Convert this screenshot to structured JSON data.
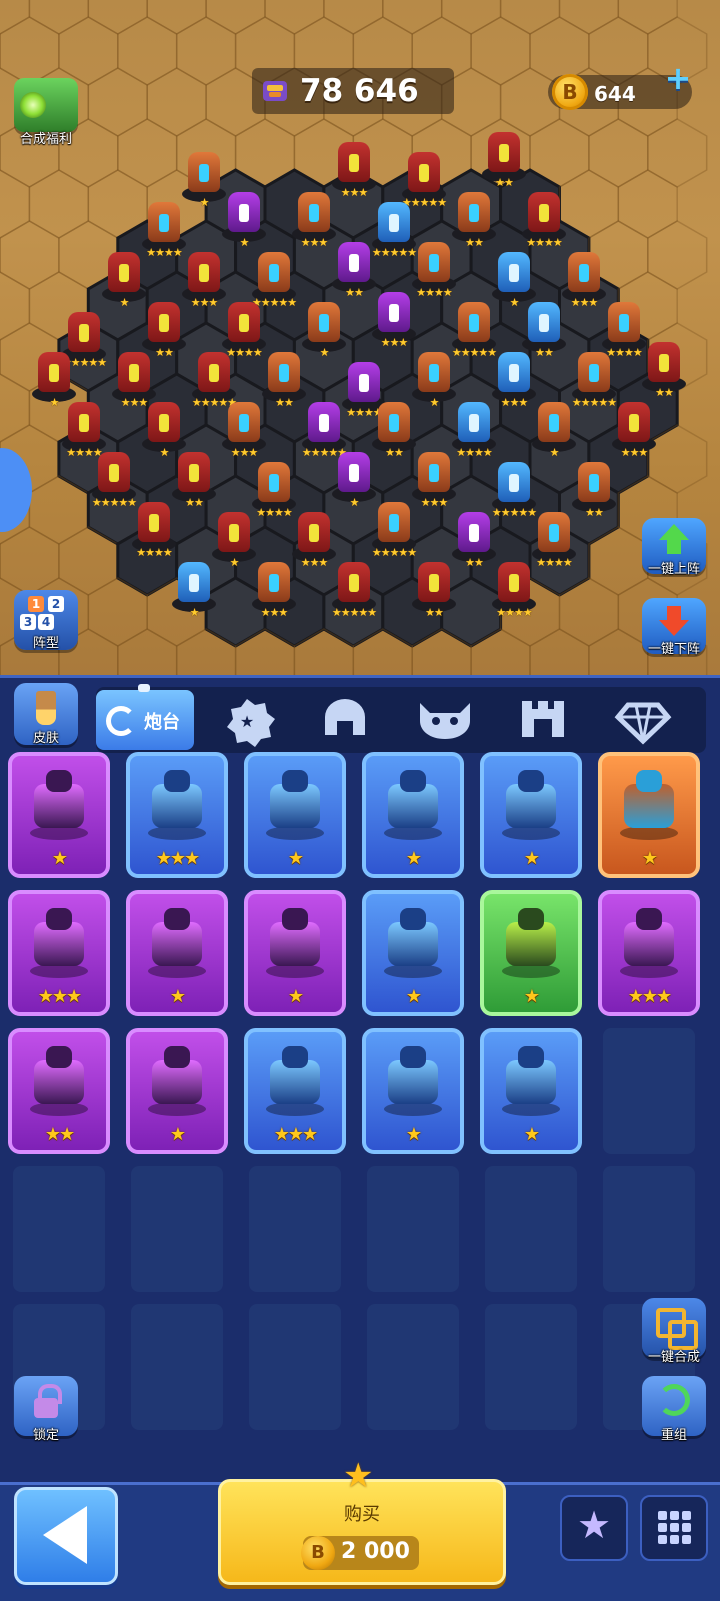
{
  "hud": {
    "score": "78 646",
    "coins": "644",
    "coin_symbol": "B",
    "plus_icon": "plus-icon"
  },
  "left_buttons": {
    "welfare_label": "合成福利",
    "formation_label": "阵型",
    "formation_digits": [
      "1",
      "2",
      "3",
      "4"
    ]
  },
  "right_buttons": {
    "deploy_all_label": "一键上阵",
    "remove_all_label": "一键下阵"
  },
  "tabs": {
    "skin_label": "皮肤",
    "active_label": "炮台",
    "items": [
      {
        "name": "turret",
        "icon": "turret-ring-icon"
      },
      {
        "name": "gear",
        "icon": "gear-badge-icon"
      },
      {
        "name": "helmet",
        "icon": "helmet-icon"
      },
      {
        "name": "skull",
        "icon": "horned-skull-icon"
      },
      {
        "name": "fortress",
        "icon": "fortress-icon"
      },
      {
        "name": "gem",
        "icon": "diamond-icon"
      }
    ]
  },
  "inventory": {
    "rows": [
      [
        {
          "color": "purple",
          "stars": "★"
        },
        {
          "color": "blue",
          "stars": "★★★"
        },
        {
          "color": "blue",
          "stars": "★"
        },
        {
          "color": "blue",
          "stars": "★"
        },
        {
          "color": "blue",
          "stars": "★"
        },
        {
          "color": "orange",
          "stars": "★"
        }
      ],
      [
        {
          "color": "purple",
          "stars": "★★★"
        },
        {
          "color": "purple",
          "stars": "★"
        },
        {
          "color": "purple",
          "stars": "★"
        },
        {
          "color": "blue",
          "stars": "★"
        },
        {
          "color": "green",
          "stars": "★"
        },
        {
          "color": "purple",
          "stars": "★★★"
        }
      ],
      [
        {
          "color": "purple",
          "stars": "★★"
        },
        {
          "color": "purple",
          "stars": "★"
        },
        {
          "color": "blue",
          "stars": "★★★"
        },
        {
          "color": "blue",
          "stars": "★"
        },
        {
          "color": "blue",
          "stars": "★"
        },
        {
          "color": "empty",
          "stars": ""
        }
      ]
    ],
    "empty_rows": 3
  },
  "panel_buttons": {
    "merge_label": "一键合成",
    "lock_label": "锁定",
    "reset_label": "重组"
  },
  "bottom": {
    "buy_label": "购买",
    "buy_price": "2 000",
    "coin_symbol": "B"
  },
  "colors": {
    "purple": "#c14fe9",
    "blue": "#5a9cf7",
    "orange": "#ff9a4a",
    "green": "#78e46a",
    "panel": "#1b2d6b",
    "sand": "#b78a48"
  }
}
